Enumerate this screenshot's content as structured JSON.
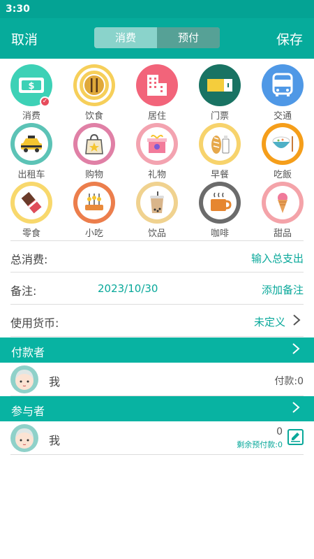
{
  "status": {
    "time": "3:30"
  },
  "header": {
    "cancel": "取消",
    "save": "保存",
    "tabs": [
      {
        "label": "消费",
        "active": true
      },
      {
        "label": "预付",
        "active": false
      }
    ]
  },
  "categories": [
    {
      "label": "消费",
      "icon": "money-icon",
      "selected": true
    },
    {
      "label": "饮食",
      "icon": "fork-knife-icon"
    },
    {
      "label": "居住",
      "icon": "building-icon"
    },
    {
      "label": "门票",
      "icon": "ticket-icon"
    },
    {
      "label": "交通",
      "icon": "bus-icon"
    },
    {
      "label": "出租车",
      "icon": "taxi-icon"
    },
    {
      "label": "购物",
      "icon": "shopping-bag-icon"
    },
    {
      "label": "礼物",
      "icon": "gift-icon"
    },
    {
      "label": "早餐",
      "icon": "bread-milk-icon"
    },
    {
      "label": "吃飯",
      "icon": "rice-bowl-icon"
    },
    {
      "label": "零食",
      "icon": "chocolate-icon"
    },
    {
      "label": "小吃",
      "icon": "skewer-icon"
    },
    {
      "label": "饮品",
      "icon": "bubble-tea-icon"
    },
    {
      "label": "咖啡",
      "icon": "coffee-icon"
    },
    {
      "label": "甜品",
      "icon": "ice-cream-icon"
    }
  ],
  "form": {
    "total_label": "总消费:",
    "total_action": "输入总支出",
    "note_label": "备注:",
    "date": "2023/10/30",
    "note_action": "添加备注",
    "currency_label": "使用货币:",
    "currency_value": "未定义"
  },
  "payers": {
    "title": "付款者",
    "person": {
      "name": "我",
      "pay": "付款:0"
    }
  },
  "participants": {
    "title": "参与者",
    "person": {
      "name": "我",
      "amount": "0",
      "remain": "剩余预付款:0"
    }
  },
  "colors": {
    "accent": "#06ab9b",
    "ring_money": "#3dd1b6",
    "ring_food": "#f6cf5a",
    "ring_house": "#f2647a",
    "ring_ticket": "#197363",
    "ring_bus": "#4f98e6",
    "ring_taxi": "#5cc3b6",
    "ring_shop": "#e080a6",
    "ring_gift": "#f3a3b0",
    "ring_breakfast": "#f7d36c",
    "ring_rice": "#f59e1a",
    "ring_snack": "#f8d86c",
    "ring_skewer": "#ec7e4c",
    "ring_drink": "#f0d28f",
    "ring_coffee": "#6b6b6b",
    "ring_dessert": "#f4a3a9"
  }
}
